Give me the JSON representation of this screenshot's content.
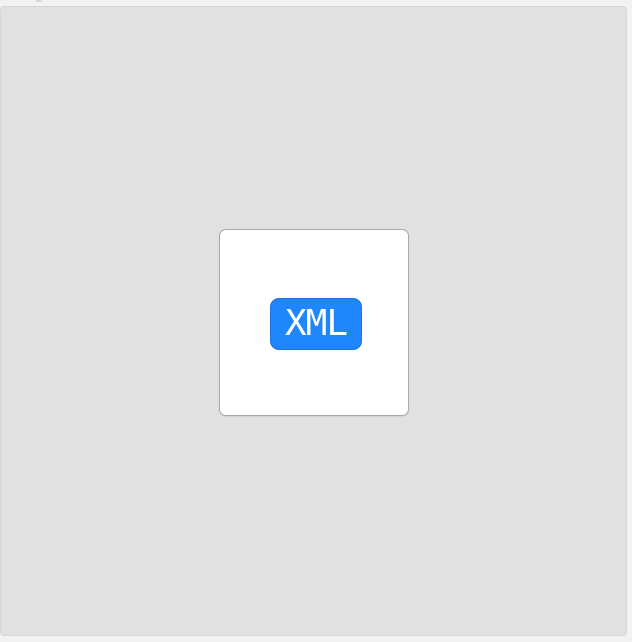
{
  "file_preview": {
    "format_label": "XML",
    "icon": "xml-file-icon"
  },
  "colors": {
    "badge_background": "#1f87fb",
    "badge_border": "#1874dc",
    "badge_text": "#ffffff"
  }
}
